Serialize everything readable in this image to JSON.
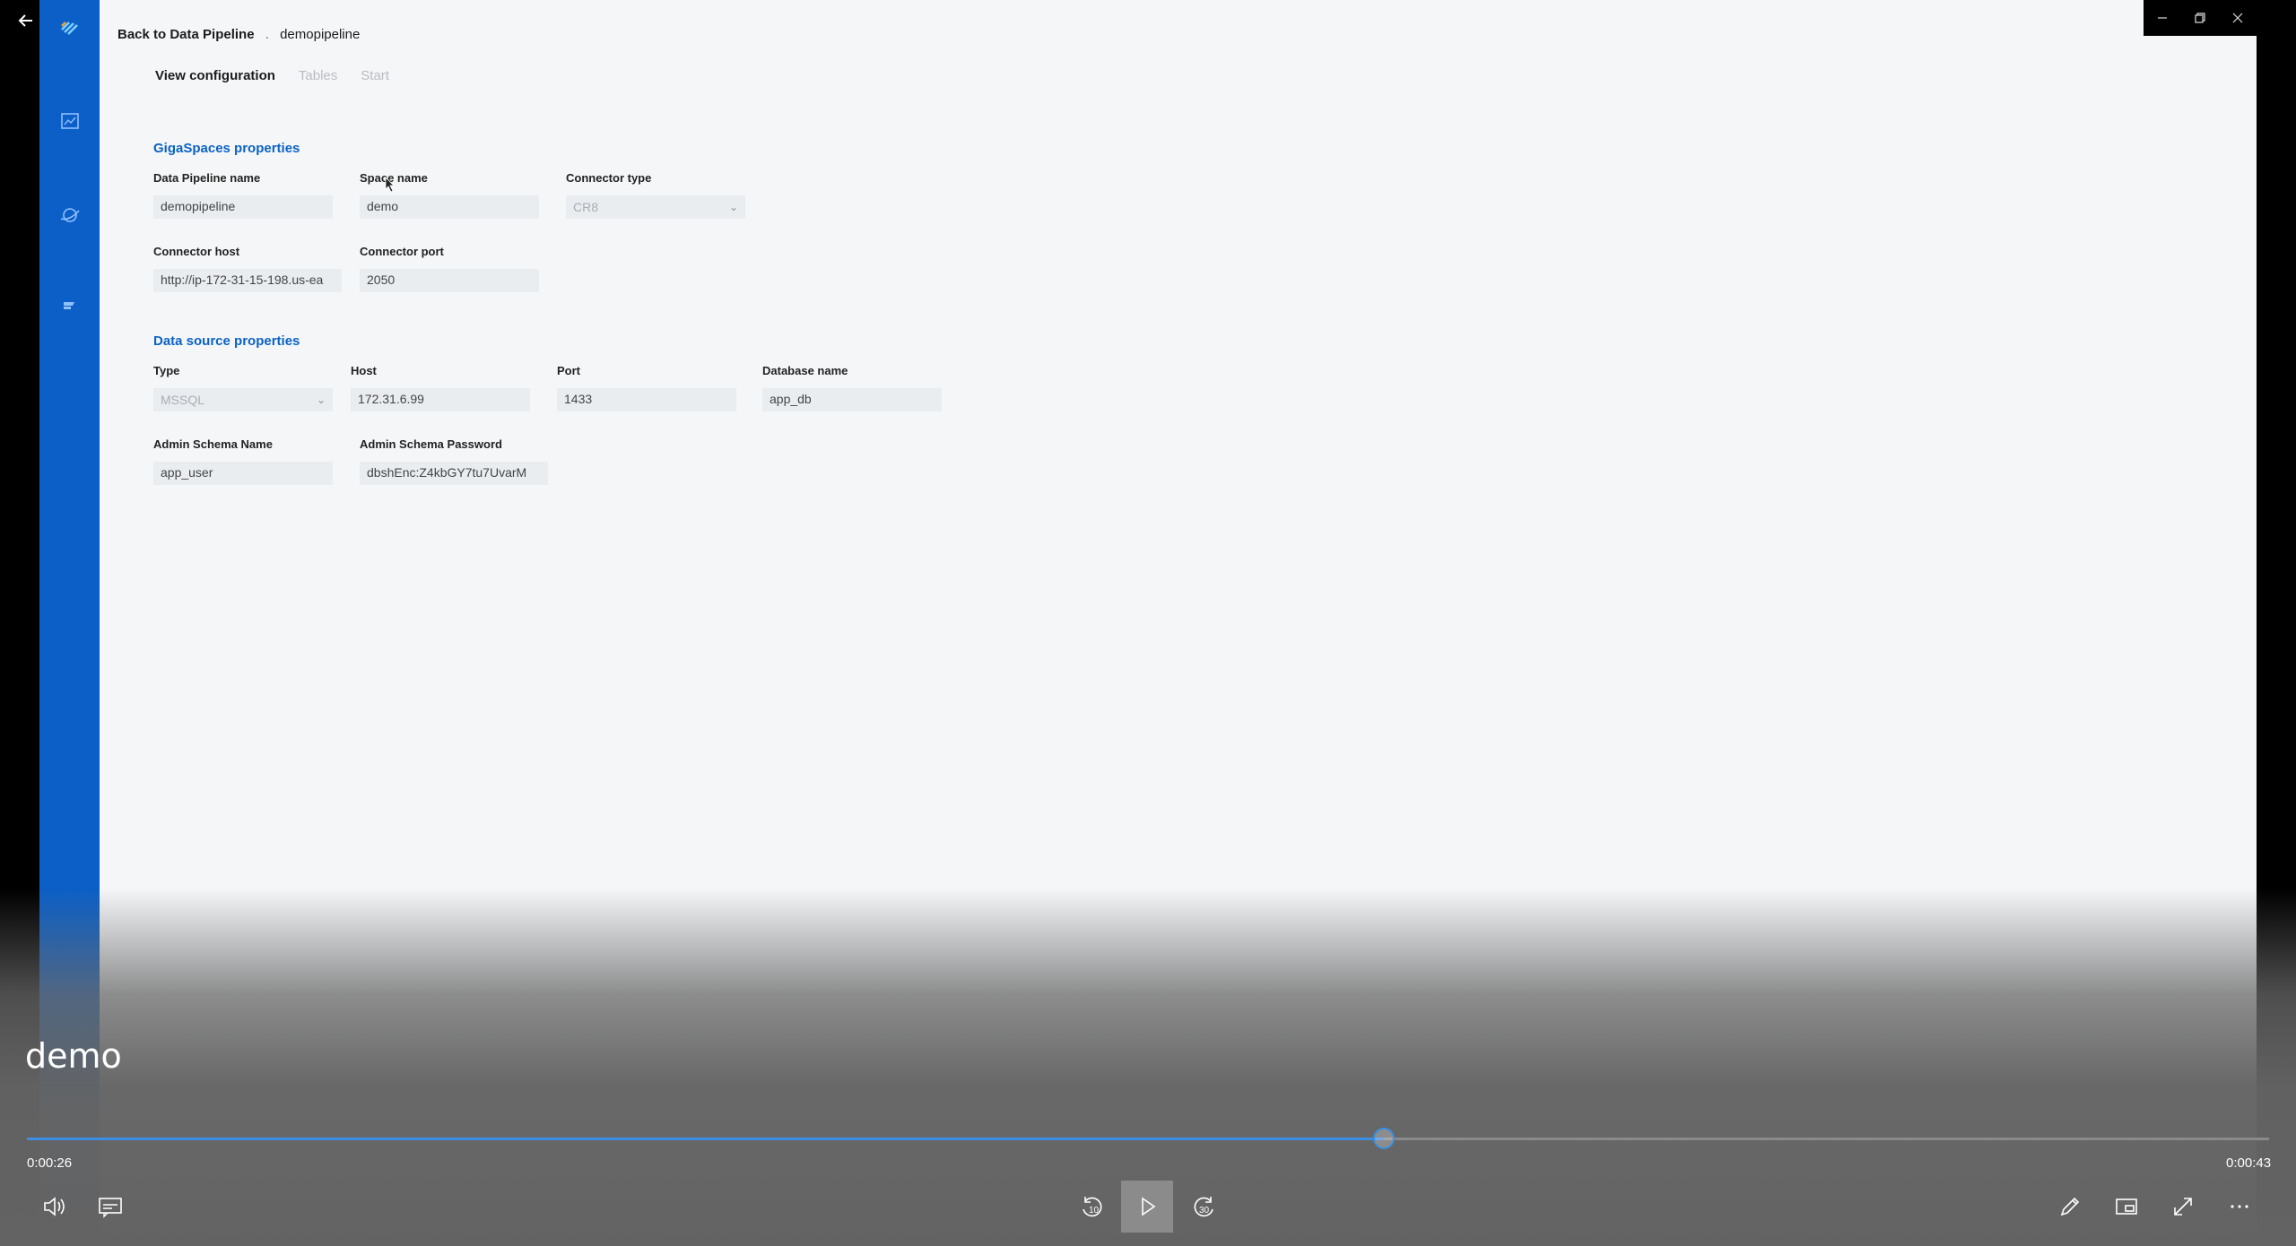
{
  "breadcrumb": {
    "back_label": "Back to Data Pipeline",
    "separator": ".",
    "current": "demopipeline"
  },
  "tabs": [
    {
      "label": "View configuration",
      "active": true
    },
    {
      "label": "Tables",
      "active": false
    },
    {
      "label": "Start",
      "active": false
    }
  ],
  "gigaspaces": {
    "title": "GigaSpaces properties",
    "pipeline_name": {
      "label": "Data Pipeline name",
      "value": "demopipeline"
    },
    "space_name": {
      "label": "Space name",
      "value": "demo"
    },
    "connector_type": {
      "label": "Connector type",
      "value": "CR8"
    },
    "connector_host": {
      "label": "Connector host",
      "value": "http://ip-172-31-15-198.us-ea"
    },
    "connector_port": {
      "label": "Connector port",
      "value": "2050"
    }
  },
  "datasource": {
    "title": "Data source properties",
    "type": {
      "label": "Type",
      "value": "MSSQL"
    },
    "host": {
      "label": "Host",
      "value": "172.31.6.99"
    },
    "port": {
      "label": "Port",
      "value": "1433"
    },
    "database": {
      "label": "Database name",
      "value": "app_db"
    },
    "admin_schema_name": {
      "label": "Admin Schema Name",
      "value": "app_user"
    },
    "admin_schema_password": {
      "label": "Admin Schema Password",
      "value": "dbshEnc:Z4kbGY7tu7UvarM"
    }
  },
  "player": {
    "title": "demo",
    "current_time": "0:00:26",
    "total_time": "0:00:43",
    "progress": 0.605,
    "accent_color": "#3b8ee2",
    "icons": [
      "volume-icon",
      "subtitles-icon",
      "rewind-10-icon",
      "play-icon",
      "forward-30-icon",
      "pen-icon",
      "mini-view-icon",
      "fullscreen-icon",
      "more-icon"
    ]
  },
  "colors": {
    "sidebar": "#0b5fc7",
    "link": "#0b63c4",
    "background": "#f4f6f8"
  }
}
